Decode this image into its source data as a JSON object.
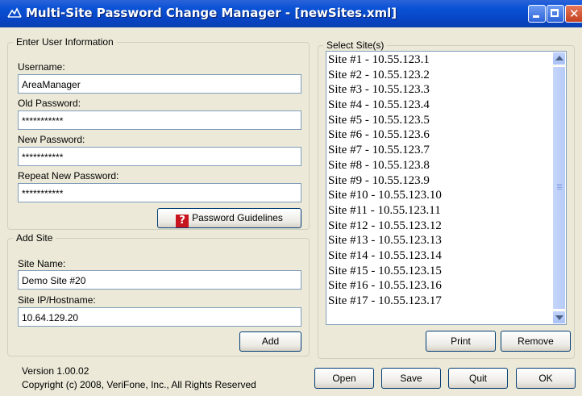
{
  "window": {
    "title": "Multi-Site Password Change Manager - [newSites.xml]"
  },
  "user_info": {
    "legend": "Enter User Information",
    "username_label": "Username:",
    "username_value": "AreaManager",
    "old_password_label": "Old Password:",
    "old_password_value": "***********",
    "new_password_label": "New Password:",
    "new_password_value": "***********",
    "repeat_password_label": "Repeat New Password:",
    "repeat_password_value": "***********",
    "guidelines_button": "Password Guidelines",
    "guidelines_icon_glyph": "?"
  },
  "add_site": {
    "legend": "Add Site",
    "site_name_label": "Site Name:",
    "site_name_value": "Demo Site #20",
    "site_ip_label": "Site IP/Hostname:",
    "site_ip_value": "10.64.129.20",
    "add_button": "Add"
  },
  "select_sites": {
    "legend": "Select Site(s)",
    "sites": [
      "Site #1 - 10.55.123.1",
      "Site #2 - 10.55.123.2",
      "Site #3 - 10.55.123.3",
      "Site #4 - 10.55.123.4",
      "Site #5 - 10.55.123.5",
      "Site #6 - 10.55.123.6",
      "Site #7 - 10.55.123.7",
      "Site #8 - 10.55.123.8",
      "Site #9 - 10.55.123.9",
      "Site #10 - 10.55.123.10",
      "Site #11 - 10.55.123.11",
      "Site #12 - 10.55.123.12",
      "Site #13 - 10.55.123.13",
      "Site #14 - 10.55.123.14",
      "Site #15 - 10.55.123.15",
      "Site #16 - 10.55.123.16",
      "Site #17 - 10.55.123.17"
    ],
    "print_button": "Print",
    "remove_button": "Remove"
  },
  "footer": {
    "version": "Version 1.00.02",
    "copyright": "Copyright (c) 2008, VeriFone, Inc., All Rights Reserved",
    "open_button": "Open",
    "save_button": "Save",
    "quit_button": "Quit",
    "ok_button": "OK"
  },
  "colors": {
    "titlebar": "#0a52d6",
    "window_face": "#ece9d8",
    "close_button": "#c3401f",
    "help_icon": "#c8141e"
  },
  "icons": {
    "app": "app-logo-icon",
    "minimize": "minimize-icon",
    "maximize": "maximize-icon",
    "close": "close-icon",
    "help": "help-icon"
  }
}
